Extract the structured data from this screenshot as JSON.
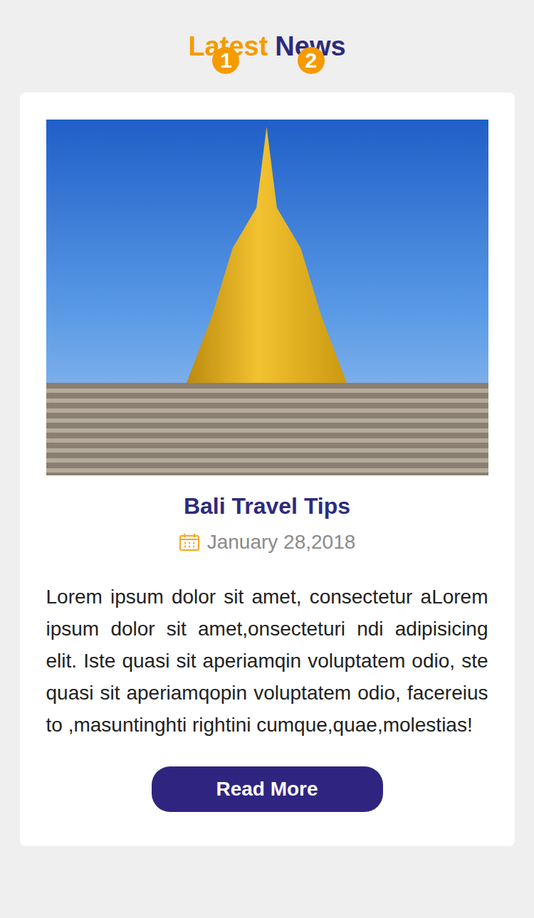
{
  "header": {
    "title_first": "Latest",
    "title_second": "News",
    "badges": [
      {
        "label": "1"
      },
      {
        "label": "2"
      }
    ]
  },
  "post": {
    "title": "Bali Travel Tips",
    "date": "January 28,2018",
    "body": "Lorem ipsum dolor sit amet, consectetur aLorem ipsum dolor sit amet,onsecteturi ndi adipisicing elit. Iste quasi sit aperiamqin voluptatem odio, ste quasi sit aperiamqopin voluptatem odio, facereius to ,masuntinghti rightini cumque,quae,molestias!",
    "button": "Read More"
  }
}
